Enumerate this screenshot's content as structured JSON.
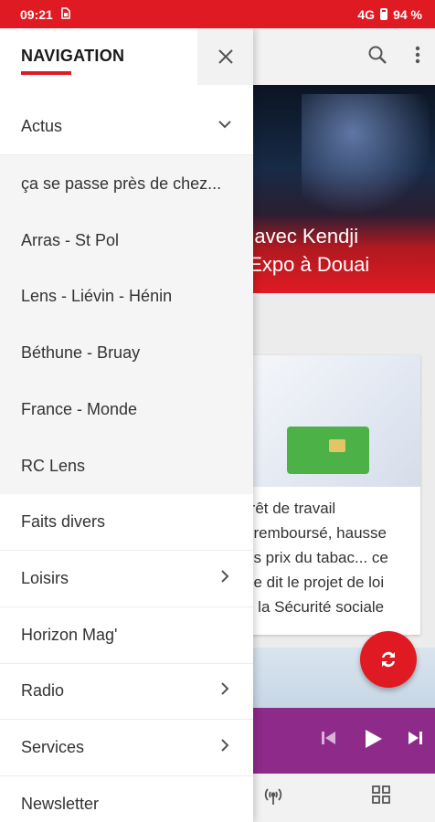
{
  "status_bar": {
    "time": "09:21",
    "sim_icon": "sim-icon",
    "network": "4G",
    "battery": "94 %"
  },
  "background": {
    "hero_title_line1": "é avec Kendji",
    "hero_title_line2": "t Expo à Douai",
    "card_text": [
      "rrêt de travail",
      "éremboursé, hausse",
      "es prix du tabac... ce",
      "ue dit le projet de loi",
      "e la Sécurité sociale"
    ],
    "vitale_label": "vitale"
  },
  "drawer": {
    "title": "NAVIGATION",
    "close_icon": "close-icon",
    "items": [
      {
        "label": "Actus",
        "chevron": "chevron-down-icon",
        "sub": false
      },
      {
        "label": "ça se passe près de chez...",
        "chevron": "",
        "sub": true
      },
      {
        "label": "Arras - St Pol",
        "chevron": "",
        "sub": true
      },
      {
        "label": "Lens - Liévin - Hénin",
        "chevron": "",
        "sub": true
      },
      {
        "label": "Béthune - Bruay",
        "chevron": "",
        "sub": true
      },
      {
        "label": "France - Monde",
        "chevron": "",
        "sub": true
      },
      {
        "label": "RC Lens",
        "chevron": "",
        "sub": true
      },
      {
        "label": "Faits divers",
        "chevron": "",
        "sub": false
      },
      {
        "label": "Loisirs",
        "chevron": "chevron-right-icon",
        "sub": false
      },
      {
        "label": "Horizon Mag'",
        "chevron": "",
        "sub": false
      },
      {
        "label": "Radio",
        "chevron": "chevron-right-icon",
        "sub": false
      },
      {
        "label": "Services",
        "chevron": "chevron-right-icon",
        "sub": false
      },
      {
        "label": "Newsletter",
        "chevron": "",
        "sub": false
      }
    ]
  },
  "colors": {
    "accent": "#e01a22",
    "player": "#8e2a8a"
  }
}
